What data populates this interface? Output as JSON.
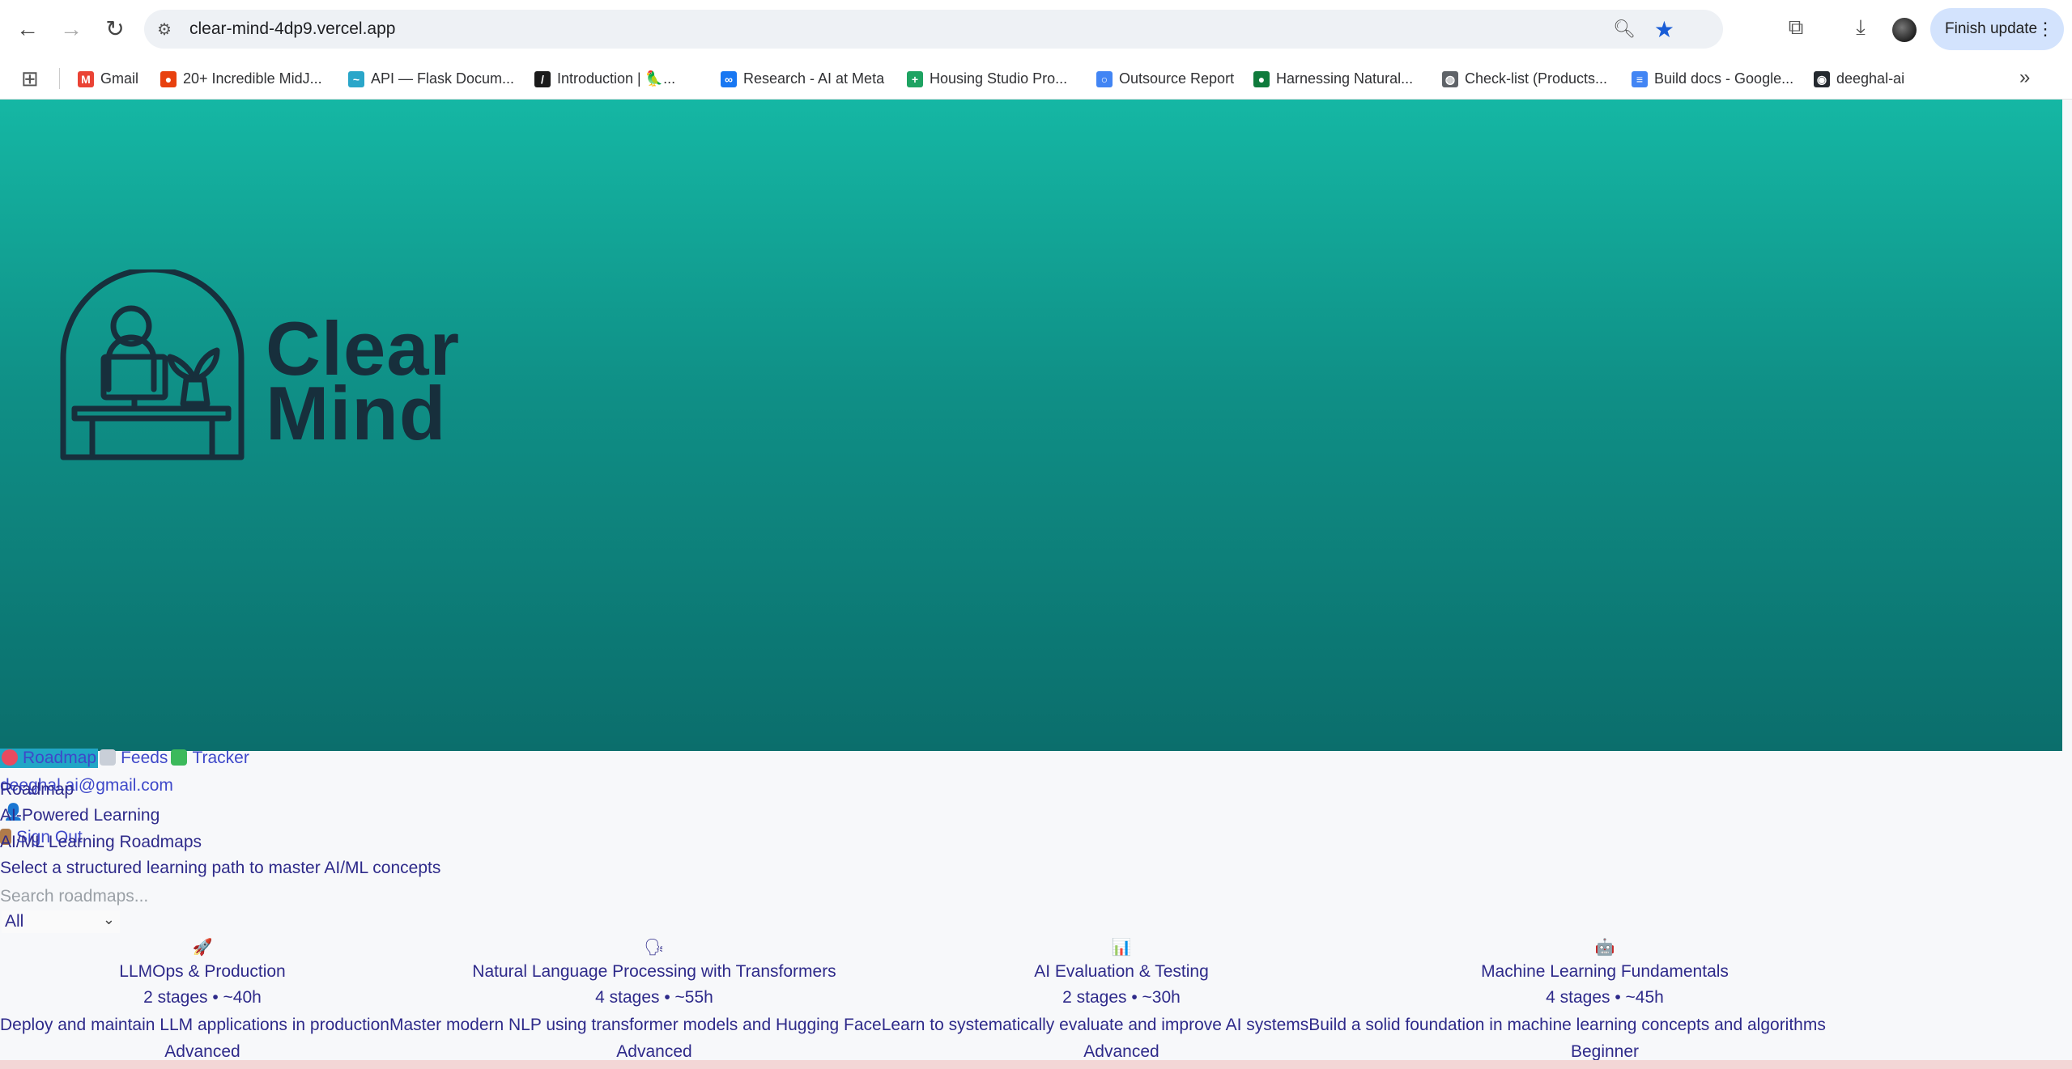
{
  "browser": {
    "url": "clear-mind-4dp9.vercel.app",
    "update_button": "Finish update",
    "bookmarks": [
      {
        "label": "Gmail",
        "color": "#ea4335",
        "glyph": "M"
      },
      {
        "label": "20+ Incredible MidJ...",
        "color": "#e8410f",
        "glyph": "●"
      },
      {
        "label": "API — Flask Docum...",
        "color": "#2aa6c9",
        "glyph": "~"
      },
      {
        "label": "Introduction | 🦜...",
        "color": "#1a1a1a",
        "glyph": "/"
      },
      {
        "label": "Research - AI at Meta",
        "color": "#1877f2",
        "glyph": "∞"
      },
      {
        "label": "Housing Studio Pro...",
        "color": "#1ea362",
        "glyph": "+"
      },
      {
        "label": "Outsource Report",
        "color": "#4285f4",
        "glyph": "○"
      },
      {
        "label": "Harnessing Natural...",
        "color": "#0f7b3c",
        "glyph": "●"
      },
      {
        "label": "Check-list (Products...",
        "color": "#5f6368",
        "glyph": "◍"
      },
      {
        "label": "Build docs - Google...",
        "color": "#4285f4",
        "glyph": "≡"
      },
      {
        "label": "deeghal-ai",
        "color": "#24292f",
        "glyph": "◉"
      }
    ]
  },
  "brand": {
    "line1": "Clear",
    "line2": "Mind"
  },
  "nav": {
    "roadmap": "Roadmap",
    "feeds": "Feeds",
    "tracker": "Tracker",
    "email": "deeghal.ai@gmail.com",
    "sign_out": "Sign Out"
  },
  "main": {
    "crumb": "Roadmap",
    "tag": "AI-Powered Learning",
    "heading": "AI/ML Learning Roadmaps",
    "subtitle": "Select a structured learning path to master AI/ML concepts",
    "search_placeholder": "Search roadmaps...",
    "filter_value": "All"
  },
  "roadmaps": [
    {
      "icon": "🚀",
      "title": "LLMOps & Production",
      "meta": "2 stages • ~40h",
      "description": "Deploy and maintain LLM applications in production",
      "level": "Advanced"
    },
    {
      "icon": "🗣",
      "title": "Natural Language Processing with Transformers",
      "meta": "4 stages • ~55h",
      "description": "Master modern NLP using transformer models and Hugging Face",
      "level": "Advanced"
    },
    {
      "icon": "📊",
      "title": "AI Evaluation & Testing",
      "meta": "2 stages • ~30h",
      "description": "Learn to systematically evaluate and improve AI systems",
      "level": "Advanced"
    },
    {
      "icon": "🤖",
      "title": "Machine Learning Fundamentals",
      "meta": "4 stages • ~45h",
      "description": "Build a solid foundation in machine learning concepts and algorithms",
      "level": "Beginner"
    }
  ]
}
